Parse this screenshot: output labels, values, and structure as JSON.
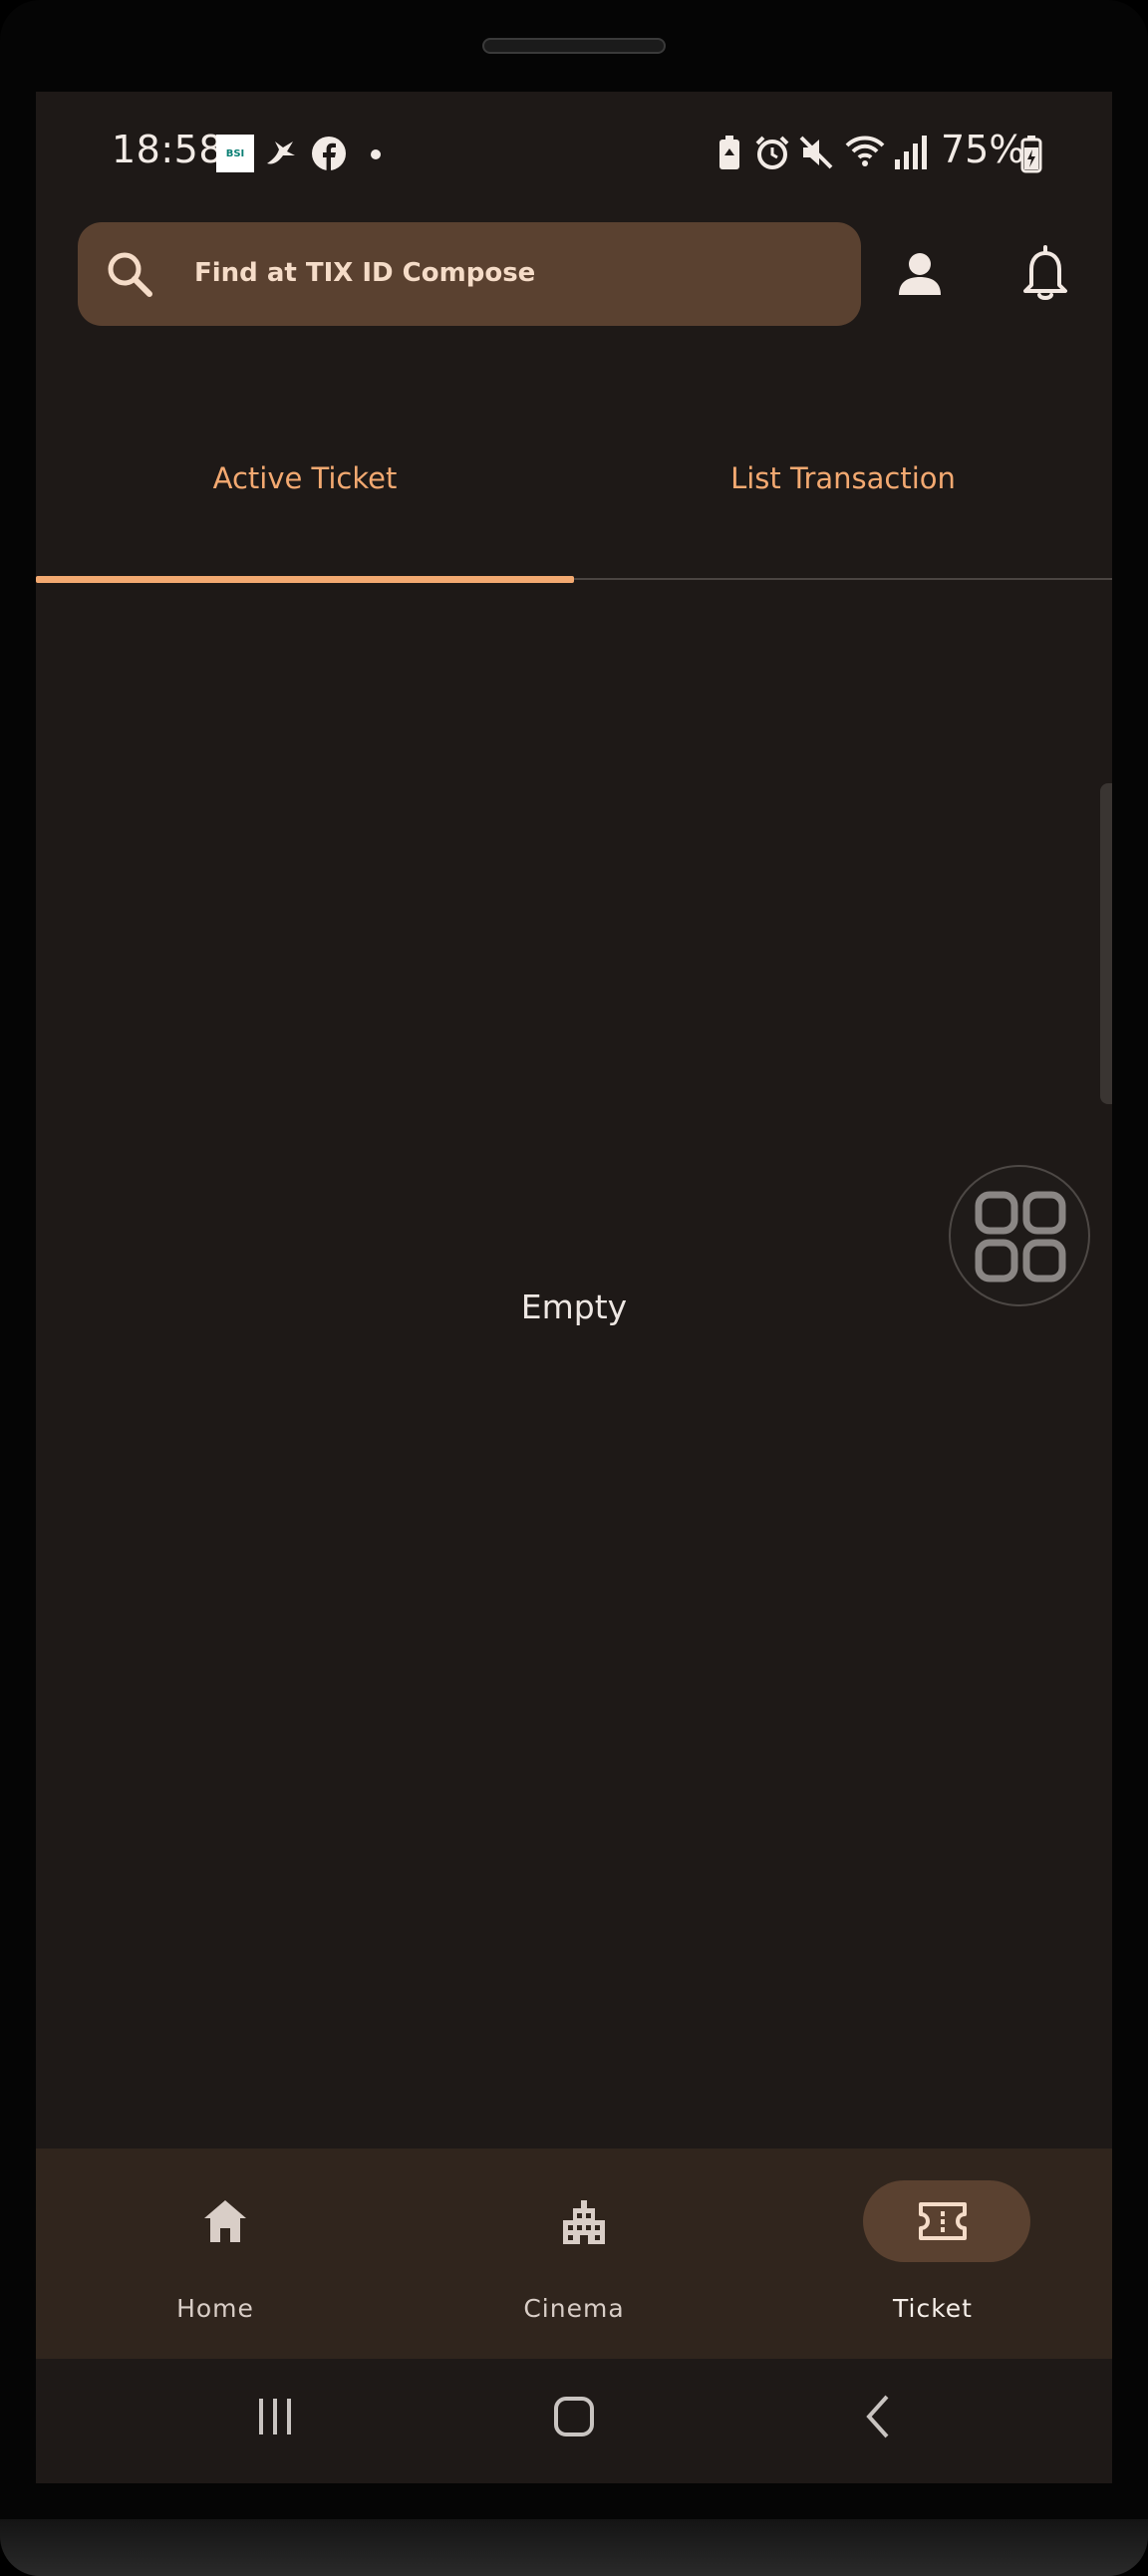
{
  "status_bar": {
    "time": "18:58",
    "notification_icons": [
      "bsi-icon",
      "bird-icon",
      "facebook-icon",
      "dot-icon"
    ],
    "bsi_label": "BSI",
    "system_icons": [
      "battery-saver-icon",
      "alarm-icon",
      "mute-icon",
      "wifi-icon",
      "signal-icon"
    ],
    "battery_percent": "75%"
  },
  "search": {
    "placeholder": "Find at TIX ID Compose"
  },
  "tabs": [
    {
      "label": "Active Ticket",
      "selected": true
    },
    {
      "label": "List Transaction",
      "selected": false
    }
  ],
  "content": {
    "empty_text": "Empty"
  },
  "bottom_nav": {
    "items": [
      {
        "label": "Home",
        "icon": "home-icon",
        "selected": false
      },
      {
        "label": "Cinema",
        "icon": "building-icon",
        "selected": false
      },
      {
        "label": "Ticket",
        "icon": "ticket-icon",
        "selected": true
      }
    ]
  },
  "colors": {
    "background": "#1e1917",
    "accent": "#f3a971",
    "search_bg": "#5a4130",
    "nav_bg": "#30251d"
  }
}
